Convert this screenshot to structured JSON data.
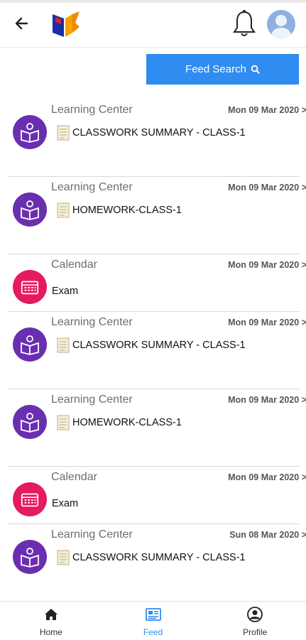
{
  "header": {
    "back_icon": "arrow-left-icon",
    "logo_icon": "school-book-logo",
    "notification_icon": "bell-icon",
    "profile_icon": "avatar-icon"
  },
  "search": {
    "label": "Feed Search",
    "icon": "search-icon"
  },
  "colors": {
    "accent": "#2f8cf0",
    "learning": "#6a2fb0",
    "calendar": "#e51a61"
  },
  "feed": [
    {
      "kind": "learning",
      "category": "Learning Center",
      "date": "Mon 09 Mar 2020 >",
      "title": "CLASSWORK SUMMARY - CLASS-1"
    },
    {
      "kind": "learning",
      "category": "Learning Center",
      "date": "Mon 09 Mar 2020 >",
      "title": "HOMEWORK-CLASS-1"
    },
    {
      "kind": "calendar",
      "category": "Calendar",
      "date": "Mon 09 Mar 2020 >",
      "title": "Exam"
    },
    {
      "kind": "learning",
      "category": "Learning Center",
      "date": "Mon 09 Mar 2020 >",
      "title": "CLASSWORK SUMMARY - CLASS-1"
    },
    {
      "kind": "learning",
      "category": "Learning Center",
      "date": "Mon 09 Mar 2020 >",
      "title": "HOMEWORK-CLASS-1"
    },
    {
      "kind": "calendar",
      "category": "Calendar",
      "date": "Mon 09 Mar 2020 >",
      "title": "Exam"
    },
    {
      "kind": "learning",
      "category": "Learning Center",
      "date": "Sun 08 Mar 2020 >",
      "title": "CLASSWORK SUMMARY - CLASS-1"
    }
  ],
  "nav": [
    {
      "label": "Home",
      "icon": "home-icon",
      "active": false
    },
    {
      "label": "Feed",
      "icon": "feed-icon",
      "active": true
    },
    {
      "label": "Profile",
      "icon": "profile-icon",
      "active": false
    }
  ]
}
